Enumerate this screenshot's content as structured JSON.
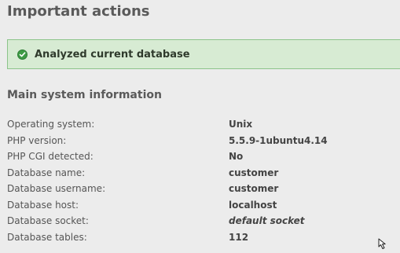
{
  "header": {
    "title": "Important actions"
  },
  "notice": {
    "icon": "check-circle-icon",
    "text": "Analyzed current database",
    "colors": {
      "background": "#d7ebd3",
      "border": "#8cc48a",
      "icon": "#3d9b44"
    }
  },
  "system_info": {
    "title": "Main system information",
    "rows": [
      {
        "label": "Operating system:",
        "value": "Unix"
      },
      {
        "label": "PHP version:",
        "value": "5.5.9-1ubuntu4.14"
      },
      {
        "label": "PHP CGI detected:",
        "value": "No"
      },
      {
        "label": "Database name:",
        "value": "customer"
      },
      {
        "label": "Database username:",
        "value": "customer"
      },
      {
        "label": "Database host:",
        "value": "localhost"
      },
      {
        "label": "Database socket:",
        "value": "default socket",
        "italic": true
      },
      {
        "label": "Database tables:",
        "value": "112"
      }
    ]
  }
}
